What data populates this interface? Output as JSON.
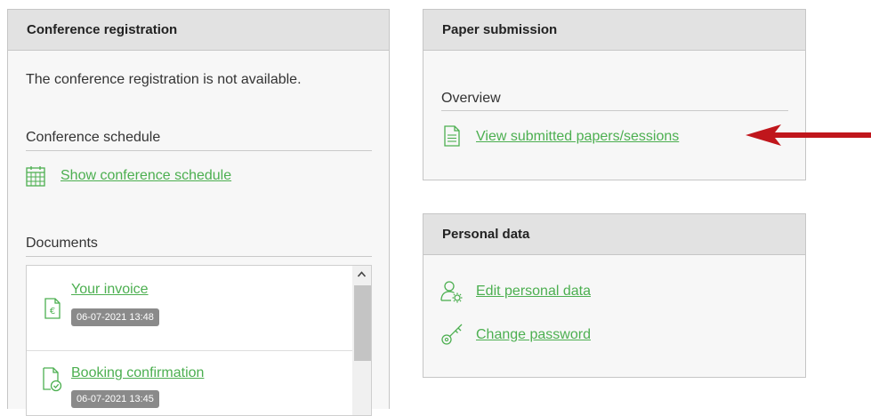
{
  "registration": {
    "header": "Conference registration",
    "not_available_text": "The conference registration is not available.",
    "schedule_title": "Conference schedule",
    "schedule_link": "Show conference schedule",
    "documents_title": "Documents",
    "documents": [
      {
        "label": "Your invoice",
        "timestamp": "06-07-2021 13:48",
        "icon": "invoice-icon"
      },
      {
        "label": "Booking confirmation",
        "timestamp": "06-07-2021 13:45",
        "icon": "confirmation-icon"
      }
    ]
  },
  "paper_submission": {
    "header": "Paper submission",
    "overview_title": "Overview",
    "view_link": "View submitted papers/sessions"
  },
  "personal_data": {
    "header": "Personal data",
    "edit_link": "Edit personal data",
    "password_link": "Change password"
  },
  "colors": {
    "link": "#4caf50",
    "arrow": "#c0161c",
    "header_bg": "#e2e2e2",
    "badge_bg": "#8a8a8a"
  }
}
